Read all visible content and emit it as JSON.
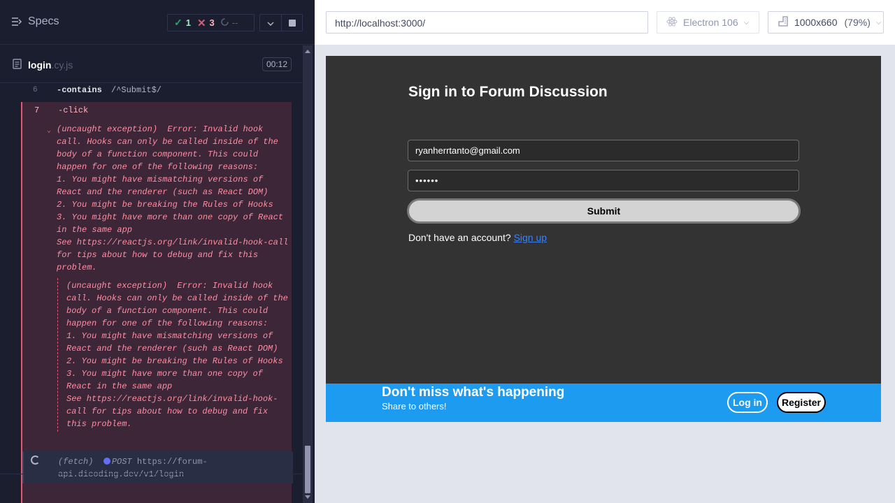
{
  "reporter": {
    "specs_label": "Specs",
    "stats": {
      "passed": "1",
      "failed": "3",
      "pending": "--"
    },
    "file": {
      "name": "login",
      "ext": ".cy.js",
      "duration": "00:12"
    },
    "commands": [
      {
        "number": "6",
        "name": "-contains",
        "message": "/^Submit$/"
      },
      {
        "number": "7",
        "name": "-click"
      }
    ],
    "error_primary": "(uncaught exception)  Error: Invalid hook\ncall. Hooks can only be called inside of the\nbody of a function component. This could\nhappen for one of the following reasons:\n1. You might have mismatching versions of\nReact and the renderer (such as React DOM)\n2. You might be breaking the Rules of Hooks\n3. You might have more than one copy of React\nin the same app\nSee https://reactjs.org/link/invalid-hook-call\nfor tips about how to debug and fix this\nproblem.",
    "error_secondary": "(uncaught exception)  Error: Invalid hook\ncall. Hooks can only be called inside of the\nbody of a function component. This could\nhappen for one of the following reasons:\n1. You might have mismatching versions of\nReact and the renderer (such as React DOM)\n2. You might be breaking the Rules of Hooks\n3. You might have more than one copy of\nReact in the same app\nSee https://reactjs.org/link/invalid-hook-\ncall for tips about how to debug and fix\nthis problem.",
    "fetch": {
      "label": "(fetch)",
      "method": "POST",
      "url_line1": "https://forum-",
      "url_line2": "api.dicoding.dev/v1/login"
    }
  },
  "browser": {
    "url": "http://localhost:3000/",
    "browser_name": "Electron 106",
    "viewport_size": "1000x660",
    "viewport_scale": "(79%)"
  },
  "app": {
    "title": "Sign in to Forum Discussion",
    "email_value": "ryanherrtanto@gmail.com",
    "password_value": "••••••",
    "submit_label": "Submit",
    "signup_prompt": "Don't have an account?",
    "signup_link": "Sign up",
    "banner": {
      "title": "Don't miss what's happening",
      "subtitle": "Share to others!",
      "login_label": "Log in",
      "register_label": "Register"
    }
  },
  "colors": {
    "reporter_bg": "#1b1e2e",
    "fail_accent": "#e45770",
    "pass_accent": "#1fa971",
    "banner_blue": "#1d9bf0",
    "app_bg": "#333333"
  },
  "icons": [
    "specs-menu-icon",
    "check-icon",
    "x-icon",
    "spinner-icon",
    "chevron-down-icon",
    "stop-icon",
    "file-icon",
    "electron-icon",
    "viewport-icon"
  ]
}
